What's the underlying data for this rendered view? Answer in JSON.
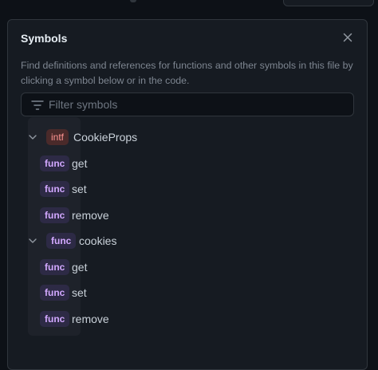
{
  "panel": {
    "title": "Symbols",
    "description": "Find definitions and references for functions and other symbols in this file by clicking a symbol below or in the code.",
    "filter": {
      "value": "",
      "placeholder": "Filter symbols"
    }
  },
  "icons": {
    "close": "close-icon",
    "filter": "filter-icon",
    "expand": "chevron-down-icon"
  },
  "colors": {
    "intf_badge_bg": "#4a2a2a",
    "intf_badge_text": "#ff9492",
    "func_badge_bg": "#2d2a45",
    "func_badge_text": "#d2a8ff"
  },
  "symbols": [
    {
      "kind": "intf",
      "name": "CookieProps",
      "expanded": true,
      "children": [
        {
          "kind": "func",
          "name": "get"
        },
        {
          "kind": "func",
          "name": "set"
        },
        {
          "kind": "func",
          "name": "remove"
        }
      ]
    },
    {
      "kind": "func",
      "name": "cookies",
      "expanded": true,
      "children": [
        {
          "kind": "func",
          "name": "get"
        },
        {
          "kind": "func",
          "name": "set"
        },
        {
          "kind": "func",
          "name": "remove"
        }
      ]
    }
  ]
}
